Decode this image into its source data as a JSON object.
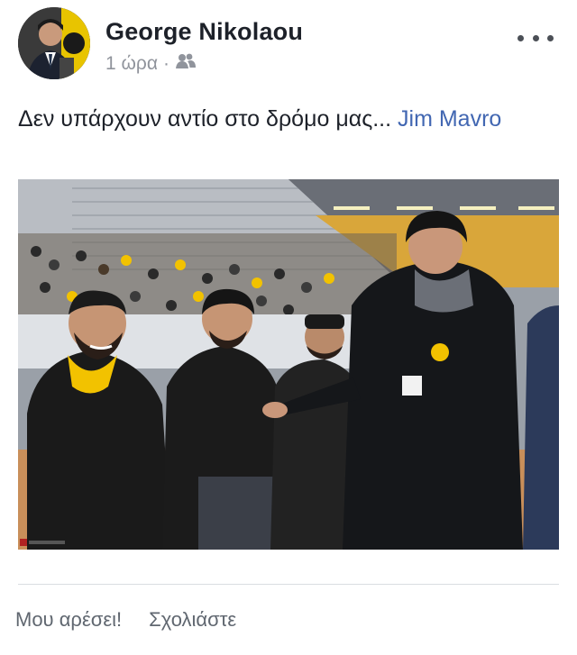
{
  "post": {
    "author": "George Nikolaou",
    "time": "1 ώρα",
    "separator": "·",
    "audience_icon": "friends-icon",
    "more_icon": "more-icon",
    "text": "Δεν υπάρχουν αντίο στο δρόμο μας... ",
    "tagged_person": "Jim Mavro"
  },
  "actions": {
    "like_label": "Μου αρέσει!",
    "comment_label": "Σχολιάστε"
  },
  "colors": {
    "author": "#1d2129",
    "meta": "#90949c",
    "link": "#4267b2",
    "action": "#606770",
    "jacket_yellow": "#f2c200"
  }
}
